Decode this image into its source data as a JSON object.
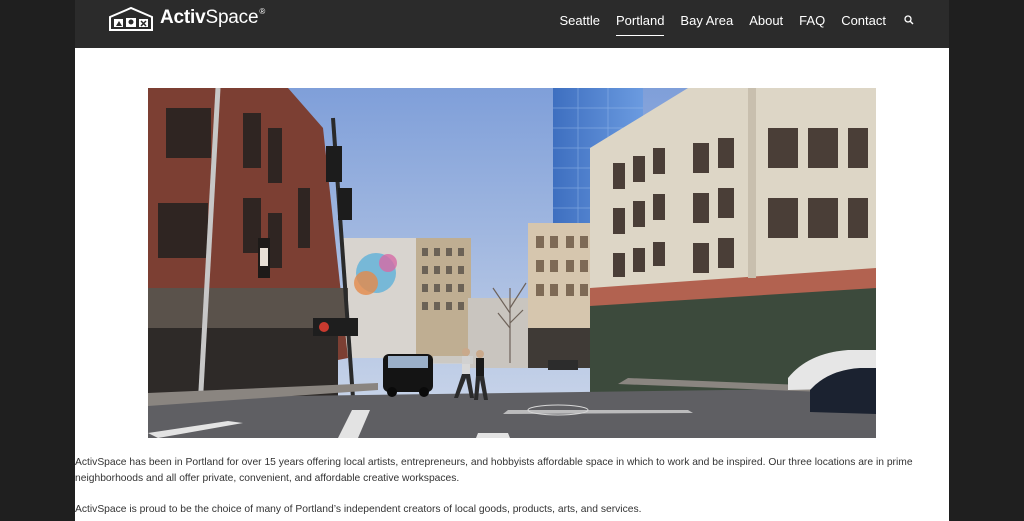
{
  "header": {
    "logo": {
      "text_bold": "Activ",
      "text_regular": "Space",
      "registered": "®",
      "icon": "activspace-logo-icon"
    },
    "nav": [
      {
        "label": "Seattle",
        "active": false
      },
      {
        "label": "Portland",
        "active": true
      },
      {
        "label": "Bay Area",
        "active": false
      },
      {
        "label": "About",
        "active": false
      },
      {
        "label": "FAQ",
        "active": false
      },
      {
        "label": "Contact",
        "active": false
      }
    ],
    "search_icon": "search-icon"
  },
  "hero": {
    "icon": "portland-street-photo"
  },
  "content": {
    "paragraphs": [
      "ActivSpace has been in Portland for over 15 years offering local artists, entrepreneurs, and hobbyists affordable space in which to work and be inspired. Our three locations are in prime neighborhoods and all offer private, convenient, and affordable creative workspaces.",
      "ActivSpace is proud to be the choice of many of Portland’s independent creators of local goods, products, arts, and services."
    ]
  },
  "colors": {
    "background": "#1f1f1f",
    "header": "#2b2b2b",
    "page": "#ffffff",
    "text": "#333333"
  }
}
